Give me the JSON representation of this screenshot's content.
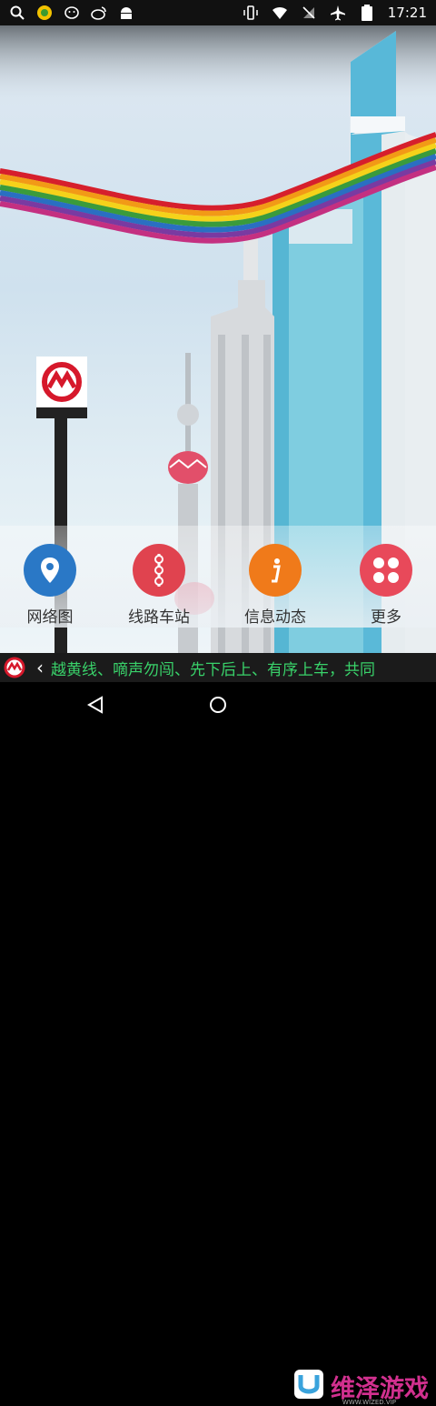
{
  "status_bar": {
    "time": "17:21",
    "left_icons": [
      "search-icon",
      "app-icon",
      "chat-icon",
      "weibo-icon",
      "android-icon"
    ],
    "right_icons": [
      "vibrate-icon",
      "wifi-icon",
      "no-sim-icon",
      "airplane-icon",
      "battery-icon"
    ]
  },
  "menu": {
    "items": [
      {
        "label": "网络图",
        "icon": "map-pin-icon",
        "color": "#2a78c6"
      },
      {
        "label": "线路车站",
        "icon": "route-icon",
        "color": "#e0434f"
      },
      {
        "label": "信息动态",
        "icon": "info-icon",
        "color": "#f07a1a"
      },
      {
        "label": "更多",
        "icon": "grid-icon",
        "color": "#e8495a"
      }
    ]
  },
  "ticker": {
    "text": "越黄线、嘀声勿闯、先下后上、有序上车，共同"
  },
  "watermark": {
    "text": "维泽游戏",
    "sub": "WWW.WIZED.VIP"
  },
  "colors": {
    "metro_red": "#d6182b",
    "ticker_text": "#39d26a"
  }
}
